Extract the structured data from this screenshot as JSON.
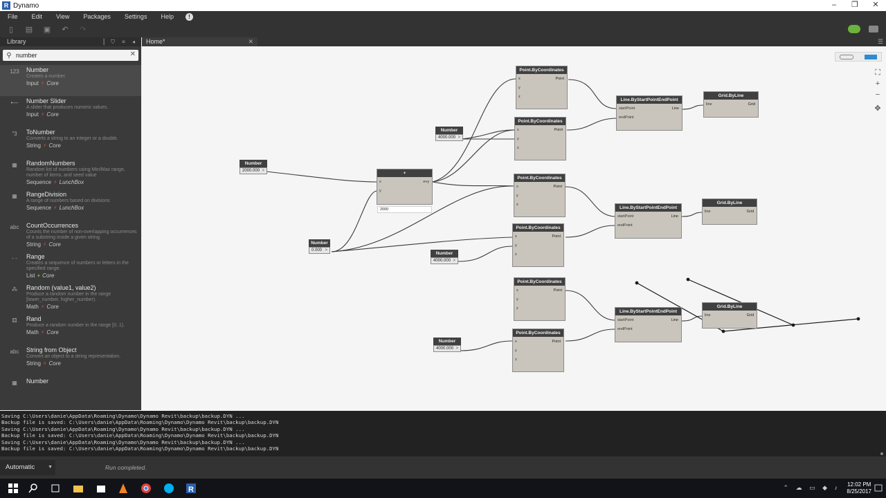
{
  "window": {
    "title": "Dynamo"
  },
  "menu": [
    "File",
    "Edit",
    "View",
    "Packages",
    "Settings",
    "Help"
  ],
  "library": {
    "header": "Library",
    "search_value": "number",
    "items": [
      {
        "name": "Number",
        "desc": "Creates a number.",
        "cat": "Input",
        "lib": "Core",
        "icon": "123",
        "selected": true
      },
      {
        "name": "Number Slider",
        "desc": "A slider that produces numeric values.",
        "cat": "Input",
        "lib": "Core",
        "icon": "•—"
      },
      {
        "name": "ToNumber",
        "desc": "Converts a string to an integer or a double.",
        "cat": "String",
        "lib": "Core",
        "icon": "\"3"
      },
      {
        "name": "RandomNumbers",
        "desc": "Random list of numbers using Min/Max range, number of items, and seed value",
        "cat": "Sequence",
        "lib": "LunchBox",
        "icon": "▦"
      },
      {
        "name": "RangeDivision",
        "desc": "A range of numbers based on divisions",
        "cat": "Sequence",
        "lib": "LunchBox",
        "icon": "▦"
      },
      {
        "name": "CountOccurrences",
        "desc": "Counts the number of non-overlapping occurrences of a substring inside a given string.",
        "cat": "String",
        "lib": "Core",
        "icon": "abc"
      },
      {
        "name": "Range",
        "desc": "Creates a sequence of numbers or letters in the specified range.",
        "cat": "List",
        "lib": "Core",
        "icon": "- -",
        "plus": true
      },
      {
        "name": "Random (value1, value2)",
        "desc": "Produce a random number in the range [lower_number, higher_number).",
        "cat": "Math",
        "lib": "Core",
        "icon": "⁂"
      },
      {
        "name": "Rand",
        "desc": "Produce a random number in the range [0, 1).",
        "cat": "Math",
        "lib": "Core",
        "icon": "⚄"
      },
      {
        "name": "String from Object",
        "desc": "Convert an object to a string representation.",
        "cat": "String",
        "lib": "Core",
        "icon": "abc"
      },
      {
        "name": "Number",
        "desc": "",
        "cat": "",
        "lib": "",
        "icon": "▦"
      }
    ]
  },
  "tab": {
    "label": "Home*"
  },
  "nodes": {
    "pbc": {
      "title": "Point.ByCoordinates",
      "in": [
        "x",
        "y",
        "z"
      ],
      "out": "Point"
    },
    "line": {
      "title": "Line.ByStartPointEndPoint",
      "in": [
        "startPoint",
        "endPoint"
      ],
      "out": "Line"
    },
    "grid": {
      "title": "Grid.ByLine",
      "in": [
        "line"
      ],
      "out": "Grid"
    },
    "add": {
      "title": "+",
      "in": [
        "x",
        "y"
      ],
      "out": "x+y",
      "preview": "2000"
    },
    "number_title": "Number",
    "numbers": [
      "2000.000",
      "4000.000",
      "0.000",
      "4000.000",
      "4000.000"
    ],
    "ports_gt": ">"
  },
  "console": {
    "lines": [
      "Saving C:\\Users\\danie\\AppData\\Roaming\\Dynamo\\Dynamo Revit\\backup\\backup.DYN ...",
      "Backup file is saved: C:\\Users\\danie\\AppData\\Roaming\\Dynamo\\Dynamo Revit\\backup\\backup.DYN",
      "Saving C:\\Users\\danie\\AppData\\Roaming\\Dynamo\\Dynamo Revit\\backup\\backup.DYN ...",
      "Backup file is saved: C:\\Users\\danie\\AppData\\Roaming\\Dynamo\\Dynamo Revit\\backup\\backup.DYN",
      "Saving C:\\Users\\danie\\AppData\\Roaming\\Dynamo\\Dynamo Revit\\backup\\backup.DYN ...",
      "Backup file is saved: C:\\Users\\danie\\AppData\\Roaming\\Dynamo\\Dynamo Revit\\backup\\backup.DYN"
    ]
  },
  "run": {
    "mode": "Automatic",
    "status": "Run completed."
  },
  "clock": {
    "time": "12:02 PM",
    "date": "8/25/2017"
  },
  "colors": {
    "accent": "#2e8ccf",
    "bolt": "#e0483c",
    "cloud": "#6cb33e"
  }
}
